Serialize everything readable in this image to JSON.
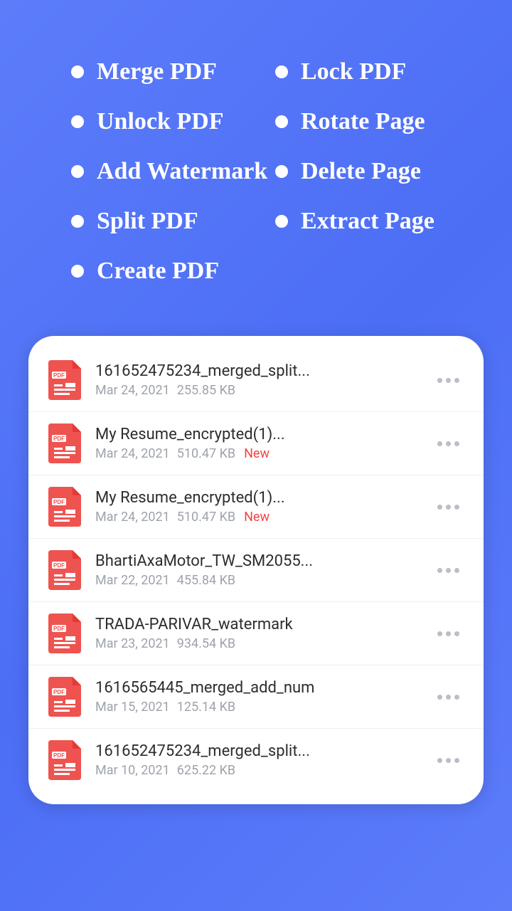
{
  "features": {
    "left": [
      "Merge PDF",
      "Unlock PDF",
      "Add Watermark",
      "Split PDF",
      "Create PDF"
    ],
    "right": [
      "Lock PDF",
      "Rotate Page",
      "Delete Page",
      "Extract Page"
    ]
  },
  "files": [
    {
      "name": "161652475234_merged_split...",
      "date": "Mar 24, 2021",
      "size": "255.85 KB",
      "isNew": false
    },
    {
      "name": "My Resume_encrypted(1)...",
      "date": "Mar 24, 2021",
      "size": "510.47 KB",
      "isNew": true
    },
    {
      "name": "My Resume_encrypted(1)...",
      "date": "Mar 24, 2021",
      "size": "510.47 KB",
      "isNew": true
    },
    {
      "name": "BhartiAxaMotor_TW_SM2055...",
      "date": "Mar 22, 2021",
      "size": "455.84 KB",
      "isNew": false
    },
    {
      "name": "TRADA-PARIVAR_watermark",
      "date": "Mar 23, 2021",
      "size": "934.54 KB",
      "isNew": false
    },
    {
      "name": "1616565445_merged_add_num",
      "date": "Mar 15, 2021",
      "size": "125.14 KB",
      "isNew": false
    },
    {
      "name": "161652475234_merged_split...",
      "date": "Mar 10, 2021",
      "size": "625.22 KB",
      "isNew": false
    }
  ],
  "newLabel": "New"
}
